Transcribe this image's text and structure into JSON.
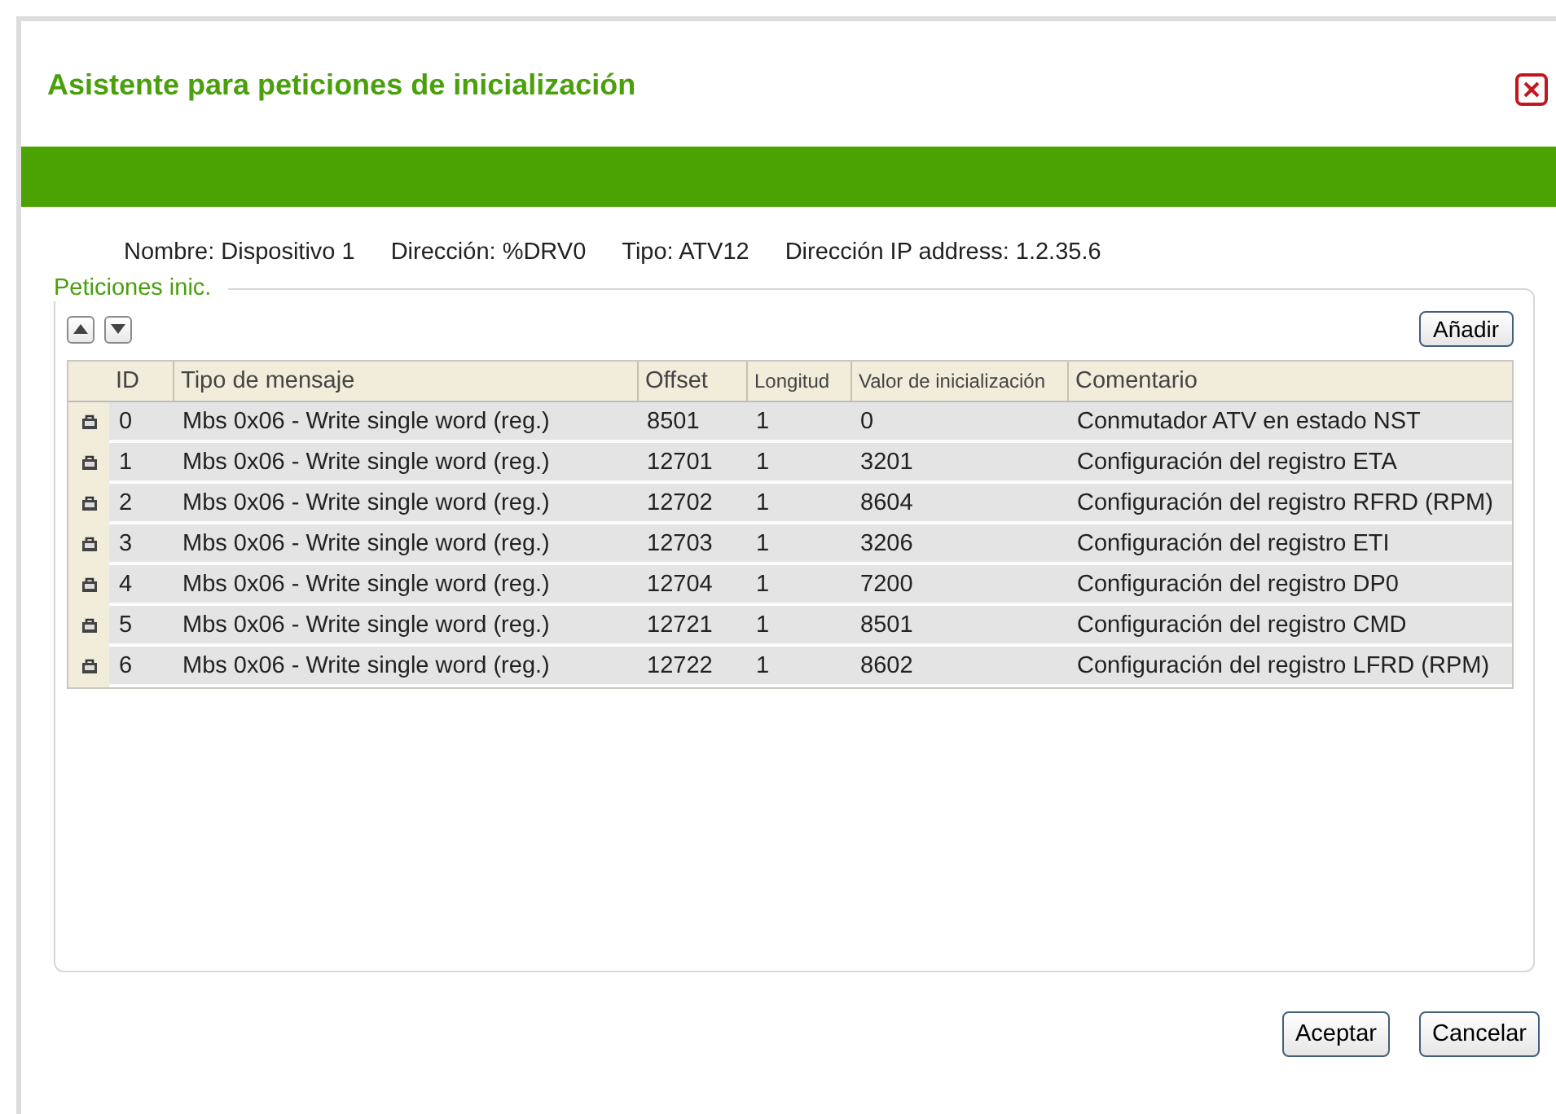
{
  "window": {
    "title": "Asistente para peticiones de inicialización"
  },
  "device_info": [
    "Nombre: Dispositivo 1",
    "Dirección: %DRV0",
    "Tipo: ATV12",
    "Dirección IP address: 1.2.35.6"
  ],
  "group": {
    "title": "Peticiones inic.",
    "add_button": "Añadir"
  },
  "table": {
    "columns": [
      "ID",
      "Tipo de mensaje",
      "Offset",
      "Longitud",
      "Valor de inicialización",
      "Comentario"
    ],
    "rows": [
      [
        "0",
        "Mbs 0x06 - Write single word (reg.)",
        "8501",
        "1",
        "0",
        "Conmutador ATV en estado NST"
      ],
      [
        "1",
        "Mbs 0x06 - Write single word (reg.)",
        "12701",
        "1",
        "3201",
        "Configuración del registro ETA"
      ],
      [
        "2",
        "Mbs 0x06 - Write single word (reg.)",
        "12702",
        "1",
        "8604",
        "Configuración del registro RFRD (RPM)"
      ],
      [
        "3",
        "Mbs 0x06 - Write single word (reg.)",
        "12703",
        "1",
        "3206",
        "Configuración del registro ETI"
      ],
      [
        "4",
        "Mbs 0x06 - Write single word (reg.)",
        "12704",
        "1",
        "7200",
        "Configuración del registro DP0"
      ],
      [
        "5",
        "Mbs 0x06 - Write single word (reg.)",
        "12721",
        "1",
        "8501",
        "Configuración del registro CMD"
      ],
      [
        "6",
        "Mbs 0x06 - Write single word (reg.)",
        "12722",
        "1",
        "8602",
        "Configuración del registro LFRD (RPM)"
      ]
    ]
  },
  "buttons": [
    "Aceptar",
    "Cancelar"
  ]
}
